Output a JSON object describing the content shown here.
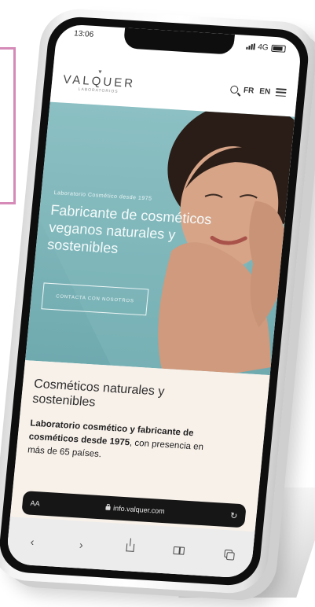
{
  "status": {
    "time": "13:06",
    "network": "4G"
  },
  "header": {
    "logo_text": "VALQUER",
    "logo_sub": "LABORATORIOS",
    "lang_fr": "FR",
    "lang_en": "EN"
  },
  "hero": {
    "eyebrow": "Laboratorio Cosmético desde 1975",
    "title": "Fabricante de cosméticos veganos naturales y sostenibles",
    "cta": "CONTACTA CON NOSOTROS"
  },
  "content": {
    "title": "Cosméticos naturales y sostenibles",
    "body_bold": "Laboratorio cosmético y fabricante de cosméticos desde 1975",
    "body_rest": ", con presencia en más de 65 países."
  },
  "browser": {
    "text_size": "AA",
    "url": "info.valquer.com",
    "reload": "↻"
  },
  "toolbar": {
    "back": "‹",
    "forward": "›"
  },
  "colors": {
    "hero_bg": "#8fc2c6",
    "content_bg": "#f8f1ea",
    "frame_accent": "#d58ab8"
  }
}
